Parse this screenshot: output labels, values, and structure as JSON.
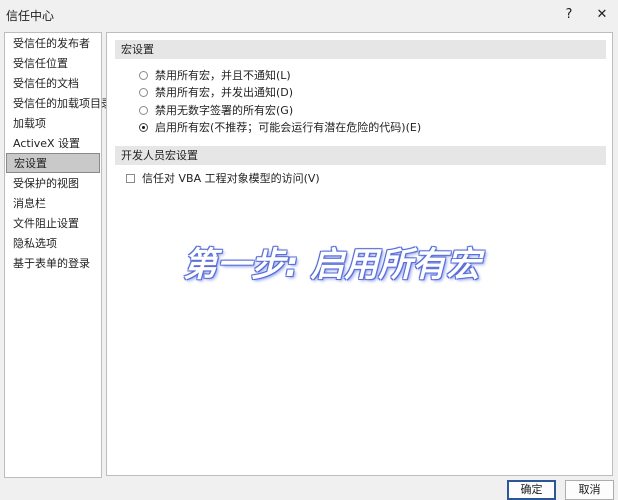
{
  "window": {
    "title": "信任中心",
    "help_glyph": "?",
    "close_glyph": "✕"
  },
  "sidebar": {
    "items": [
      {
        "label": "受信任的发布者"
      },
      {
        "label": "受信任位置"
      },
      {
        "label": "受信任的文档"
      },
      {
        "label": "受信任的加载项目录"
      },
      {
        "label": "加载项"
      },
      {
        "label": "ActiveX 设置"
      },
      {
        "label": "宏设置",
        "selected": true
      },
      {
        "label": "受保护的视图"
      },
      {
        "label": "消息栏"
      },
      {
        "label": "文件阻止设置"
      },
      {
        "label": "隐私选项"
      },
      {
        "label": "基于表单的登录"
      }
    ]
  },
  "macro_settings": {
    "header": "宏设置",
    "options": [
      {
        "label": "禁用所有宏，并且不通知(L)",
        "checked": false
      },
      {
        "label": "禁用所有宏，并发出通知(D)",
        "checked": false
      },
      {
        "label": "禁用无数字签署的所有宏(G)",
        "checked": false
      },
      {
        "label": "启用所有宏(不推荐；可能会运行有潜在危险的代码)(E)",
        "checked": true
      }
    ]
  },
  "developer_settings": {
    "header": "开发人员宏设置",
    "vba_trust_label": "信任对 VBA 工程对象模型的访问(V)",
    "vba_trust_checked": false
  },
  "overlay_text": "第一步: 启用所有宏",
  "footer": {
    "ok_label": "确定",
    "cancel_label": "取消"
  },
  "colors": {
    "selected_item": "#c9c9c9",
    "section_header": "#e6e6e6",
    "ok_border": "#2b5797",
    "overlay_outline": "#5a6fd8"
  }
}
